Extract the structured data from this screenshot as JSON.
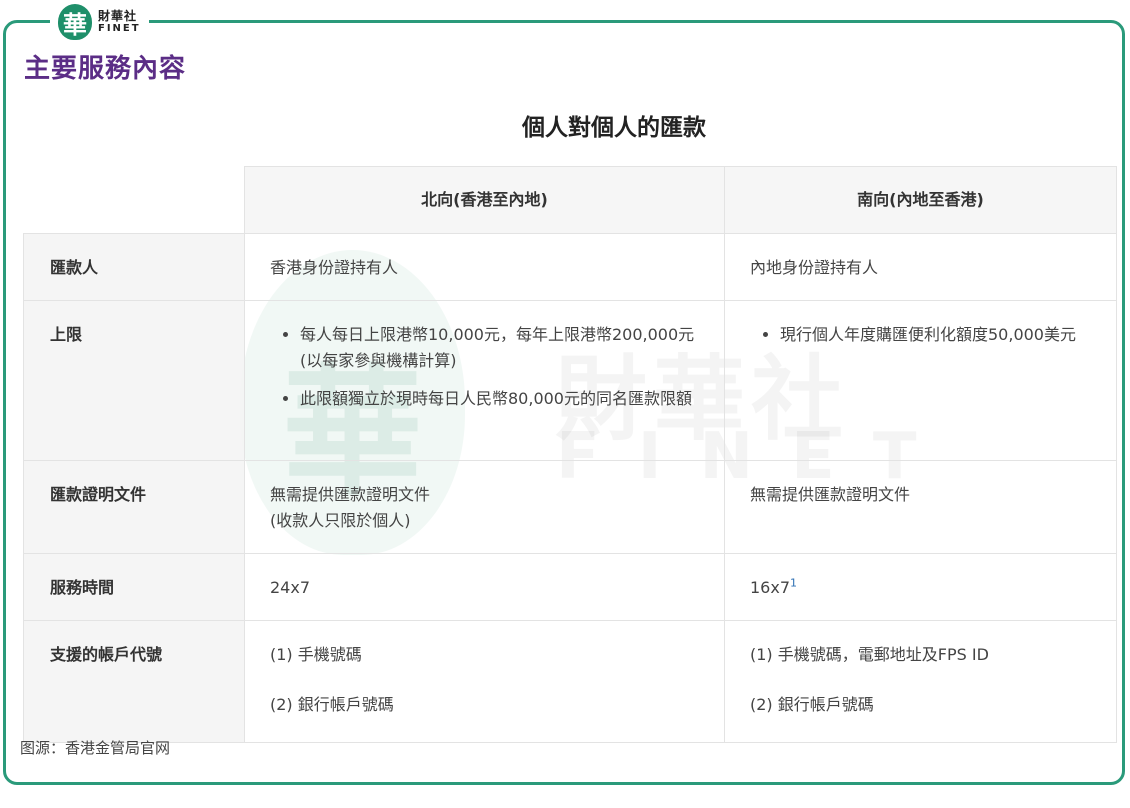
{
  "brand": {
    "seal_char": "華",
    "name_cn": "財華社",
    "name_en": "FINET"
  },
  "page_title": "主要服務內容",
  "table": {
    "title": "個人對個人的匯款",
    "columns": [
      "北向(香港至內地)",
      "南向(內地至香港)"
    ],
    "rows": [
      {
        "label": "匯款人",
        "north": [
          "香港身份證持有人"
        ],
        "south": [
          "內地身份證持有人"
        ]
      },
      {
        "label": "上限",
        "north": [
          "每人每日上限港幣10,000元，每年上限港幣200,000元(以每家參與機構計算)",
          "此限額獨立於現時每日人民幣80,000元的同名匯款限額"
        ],
        "south": [
          "現行個人年度購匯便利化額度50,000美元"
        ]
      },
      {
        "label": "匯款證明文件",
        "north": [
          "無需提供匯款證明文件",
          "(收款人只限於個人)"
        ],
        "south": [
          "無需提供匯款證明文件"
        ]
      },
      {
        "label": "服務時間",
        "north": "24x7",
        "south": "16x7",
        "south_footnote": "1"
      },
      {
        "label": "支援的帳戶代號",
        "north": [
          "(1) 手機號碼",
          "(2) 銀行帳戶號碼"
        ],
        "south": [
          "(1) 手機號碼，電郵地址及FPS ID",
          "(2) 銀行帳戶號碼"
        ]
      }
    ]
  },
  "watermark": {
    "cn": "財華社",
    "en": "FINET",
    "seal_char": "華"
  },
  "source_note": "图源：香港金管局官网",
  "colors": {
    "frame": "#2a9a7a",
    "title": "#5b2d86",
    "seal": "#1f8f6a",
    "footnote_link": "#2d6fb3"
  }
}
